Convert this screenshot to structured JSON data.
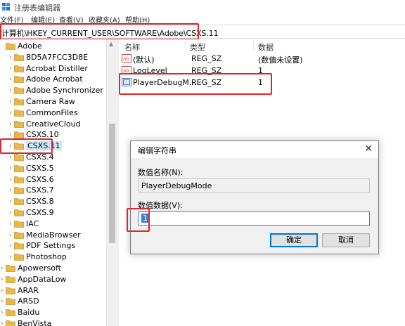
{
  "window": {
    "title": "注册表编辑器"
  },
  "menu": [
    "文件(F)",
    "编辑(E)",
    "查看(V)",
    "收藏夹(A)",
    "帮助(H)"
  ],
  "address": {
    "path": "计算机\\HKEY_CURRENT_USER\\SOFTWARE\\Adobe\\CSXS.11"
  },
  "tree": {
    "items": [
      {
        "label": "Adobe",
        "expanded": true
      },
      {
        "label": "8D5A7FCC3D8E"
      },
      {
        "label": "Acrobat Distiller"
      },
      {
        "label": "Adobe Acrobat"
      },
      {
        "label": "Adobe Synchronizer"
      },
      {
        "label": "Camera Raw"
      },
      {
        "label": "CommonFiles"
      },
      {
        "label": "CreativeCloud"
      },
      {
        "label": "CSXS.10"
      },
      {
        "label": "CSXS.11",
        "selected": true
      },
      {
        "label": "CSXS.4"
      },
      {
        "label": "CSXS.5"
      },
      {
        "label": "CSXS.6"
      },
      {
        "label": "CSXS.7"
      },
      {
        "label": "CSXS.8"
      },
      {
        "label": "CSXS.9"
      },
      {
        "label": "IAC"
      },
      {
        "label": "MediaBrowser"
      },
      {
        "label": "PDF Settings"
      },
      {
        "label": "Photoshop"
      },
      {
        "label": "Apowersoft"
      },
      {
        "label": "AppDataLow"
      },
      {
        "label": "ARAR"
      },
      {
        "label": "ARSD"
      },
      {
        "label": "Baidu"
      },
      {
        "label": "BenVista"
      }
    ]
  },
  "list": {
    "headers": {
      "name": "名称",
      "type": "类型",
      "data": "数据"
    },
    "rows": [
      {
        "name": "(默认)",
        "type": "REG_SZ",
        "data": "(数值未设置)"
      },
      {
        "name": "LogLevel",
        "type": "REG_SZ",
        "data": "1"
      },
      {
        "name": "PlayerDebugM...",
        "type": "REG_SZ",
        "data": "1"
      }
    ]
  },
  "dialog": {
    "title": "编辑字符串",
    "name_label": "数值名称(N):",
    "name_value": "PlayerDebugMode",
    "data_label": "数值数据(V):",
    "data_value": "1",
    "ok_label": "确定",
    "cancel_label": "取消"
  },
  "colors": {
    "highlight": "#e0262a",
    "folder": "#e8b84a",
    "selection": "#cce8ff",
    "accent": "#0078d7"
  }
}
